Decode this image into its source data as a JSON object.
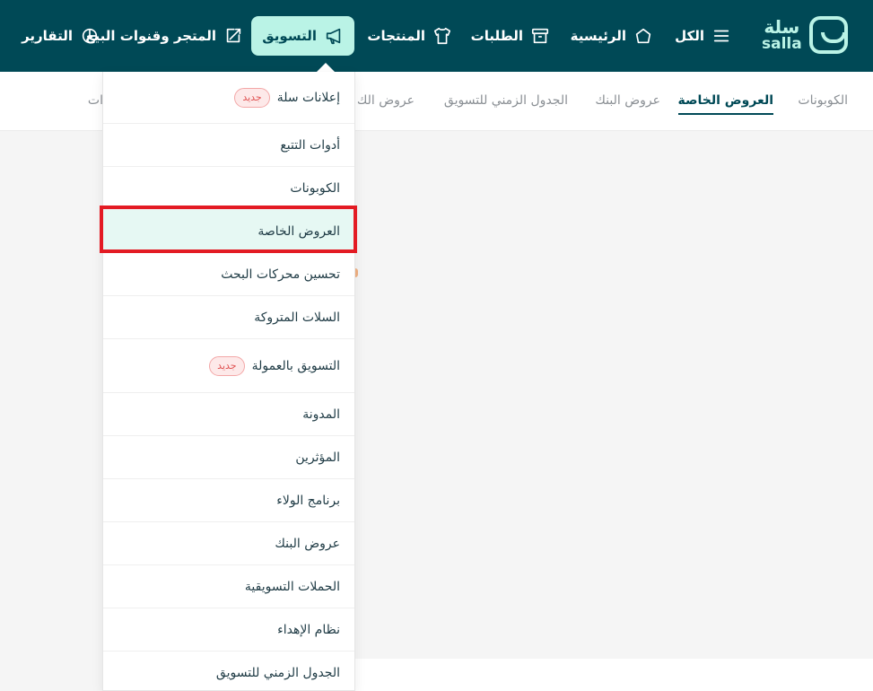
{
  "brand": {
    "name_ar": "سلة",
    "name_en": "salla"
  },
  "nav": {
    "all": "الكل",
    "home": "الرئيسية",
    "orders": "الطلبات",
    "products": "المنتجات",
    "marketing": "التسويق",
    "store_channels": "المتجر وقنوات البيع",
    "reports": "التقارير"
  },
  "subtabs": {
    "coupons": "الكوبونات",
    "special_offers": "العروض الخاصة",
    "bank_offers": "عروض البنك",
    "marketing_schedule": "الجدول الزمني للتسويق",
    "cut_offers": "عروض الك",
    "cut_last": "ات"
  },
  "dropdown": {
    "new_badge": "جديد",
    "items": [
      {
        "label": "إعلانات سلة",
        "badge": true
      },
      {
        "label": "أدوات التتبع"
      },
      {
        "label": "الكوبونات"
      },
      {
        "label": "العروض الخاصة",
        "selected": true
      },
      {
        "label": "تحسين محركات البحث"
      },
      {
        "label": "السلات المتروكة"
      },
      {
        "label": "التسويق بالعمولة",
        "badge": true
      },
      {
        "label": "المدونة"
      },
      {
        "label": "المؤثرين"
      },
      {
        "label": "برنامج الولاء"
      },
      {
        "label": "عروض البنك"
      },
      {
        "label": "الحملات التسويقية"
      },
      {
        "label": "نظام الإهداء"
      },
      {
        "label": "الجدول الزمني للتسويق"
      }
    ]
  },
  "colors": {
    "topbar": "#004956",
    "accent": "#baf3e6",
    "selected_bg": "#e6f8f3",
    "highlight": "#e31b23"
  }
}
